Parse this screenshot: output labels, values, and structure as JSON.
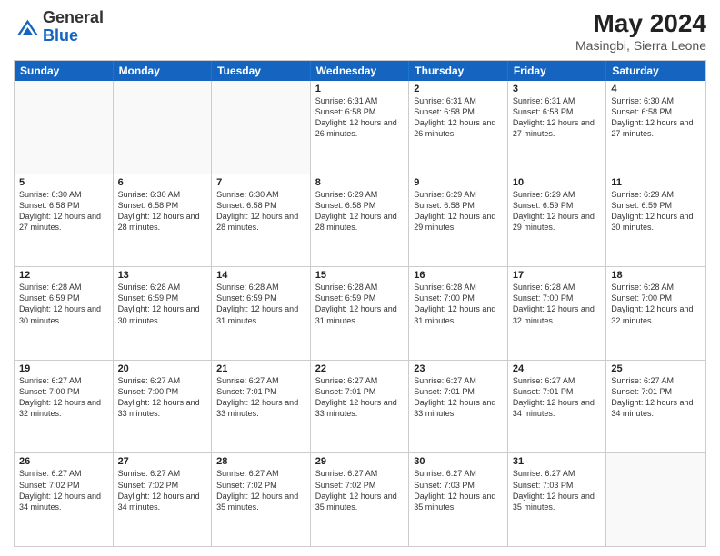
{
  "header": {
    "logo_general": "General",
    "logo_blue": "Blue",
    "month_year": "May 2024",
    "location": "Masingbi, Sierra Leone"
  },
  "days_of_week": [
    "Sunday",
    "Monday",
    "Tuesday",
    "Wednesday",
    "Thursday",
    "Friday",
    "Saturday"
  ],
  "weeks": [
    [
      {
        "day": "",
        "info": ""
      },
      {
        "day": "",
        "info": ""
      },
      {
        "day": "",
        "info": ""
      },
      {
        "day": "1",
        "info": "Sunrise: 6:31 AM\nSunset: 6:58 PM\nDaylight: 12 hours\nand 26 minutes."
      },
      {
        "day": "2",
        "info": "Sunrise: 6:31 AM\nSunset: 6:58 PM\nDaylight: 12 hours\nand 26 minutes."
      },
      {
        "day": "3",
        "info": "Sunrise: 6:31 AM\nSunset: 6:58 PM\nDaylight: 12 hours\nand 27 minutes."
      },
      {
        "day": "4",
        "info": "Sunrise: 6:30 AM\nSunset: 6:58 PM\nDaylight: 12 hours\nand 27 minutes."
      }
    ],
    [
      {
        "day": "5",
        "info": "Sunrise: 6:30 AM\nSunset: 6:58 PM\nDaylight: 12 hours\nand 27 minutes."
      },
      {
        "day": "6",
        "info": "Sunrise: 6:30 AM\nSunset: 6:58 PM\nDaylight: 12 hours\nand 28 minutes."
      },
      {
        "day": "7",
        "info": "Sunrise: 6:30 AM\nSunset: 6:58 PM\nDaylight: 12 hours\nand 28 minutes."
      },
      {
        "day": "8",
        "info": "Sunrise: 6:29 AM\nSunset: 6:58 PM\nDaylight: 12 hours\nand 28 minutes."
      },
      {
        "day": "9",
        "info": "Sunrise: 6:29 AM\nSunset: 6:58 PM\nDaylight: 12 hours\nand 29 minutes."
      },
      {
        "day": "10",
        "info": "Sunrise: 6:29 AM\nSunset: 6:59 PM\nDaylight: 12 hours\nand 29 minutes."
      },
      {
        "day": "11",
        "info": "Sunrise: 6:29 AM\nSunset: 6:59 PM\nDaylight: 12 hours\nand 30 minutes."
      }
    ],
    [
      {
        "day": "12",
        "info": "Sunrise: 6:28 AM\nSunset: 6:59 PM\nDaylight: 12 hours\nand 30 minutes."
      },
      {
        "day": "13",
        "info": "Sunrise: 6:28 AM\nSunset: 6:59 PM\nDaylight: 12 hours\nand 30 minutes."
      },
      {
        "day": "14",
        "info": "Sunrise: 6:28 AM\nSunset: 6:59 PM\nDaylight: 12 hours\nand 31 minutes."
      },
      {
        "day": "15",
        "info": "Sunrise: 6:28 AM\nSunset: 6:59 PM\nDaylight: 12 hours\nand 31 minutes."
      },
      {
        "day": "16",
        "info": "Sunrise: 6:28 AM\nSunset: 7:00 PM\nDaylight: 12 hours\nand 31 minutes."
      },
      {
        "day": "17",
        "info": "Sunrise: 6:28 AM\nSunset: 7:00 PM\nDaylight: 12 hours\nand 32 minutes."
      },
      {
        "day": "18",
        "info": "Sunrise: 6:28 AM\nSunset: 7:00 PM\nDaylight: 12 hours\nand 32 minutes."
      }
    ],
    [
      {
        "day": "19",
        "info": "Sunrise: 6:27 AM\nSunset: 7:00 PM\nDaylight: 12 hours\nand 32 minutes."
      },
      {
        "day": "20",
        "info": "Sunrise: 6:27 AM\nSunset: 7:00 PM\nDaylight: 12 hours\nand 33 minutes."
      },
      {
        "day": "21",
        "info": "Sunrise: 6:27 AM\nSunset: 7:01 PM\nDaylight: 12 hours\nand 33 minutes."
      },
      {
        "day": "22",
        "info": "Sunrise: 6:27 AM\nSunset: 7:01 PM\nDaylight: 12 hours\nand 33 minutes."
      },
      {
        "day": "23",
        "info": "Sunrise: 6:27 AM\nSunset: 7:01 PM\nDaylight: 12 hours\nand 33 minutes."
      },
      {
        "day": "24",
        "info": "Sunrise: 6:27 AM\nSunset: 7:01 PM\nDaylight: 12 hours\nand 34 minutes."
      },
      {
        "day": "25",
        "info": "Sunrise: 6:27 AM\nSunset: 7:01 PM\nDaylight: 12 hours\nand 34 minutes."
      }
    ],
    [
      {
        "day": "26",
        "info": "Sunrise: 6:27 AM\nSunset: 7:02 PM\nDaylight: 12 hours\nand 34 minutes."
      },
      {
        "day": "27",
        "info": "Sunrise: 6:27 AM\nSunset: 7:02 PM\nDaylight: 12 hours\nand 34 minutes."
      },
      {
        "day": "28",
        "info": "Sunrise: 6:27 AM\nSunset: 7:02 PM\nDaylight: 12 hours\nand 35 minutes."
      },
      {
        "day": "29",
        "info": "Sunrise: 6:27 AM\nSunset: 7:02 PM\nDaylight: 12 hours\nand 35 minutes."
      },
      {
        "day": "30",
        "info": "Sunrise: 6:27 AM\nSunset: 7:03 PM\nDaylight: 12 hours\nand 35 minutes."
      },
      {
        "day": "31",
        "info": "Sunrise: 6:27 AM\nSunset: 7:03 PM\nDaylight: 12 hours\nand 35 minutes."
      },
      {
        "day": "",
        "info": ""
      }
    ]
  ]
}
